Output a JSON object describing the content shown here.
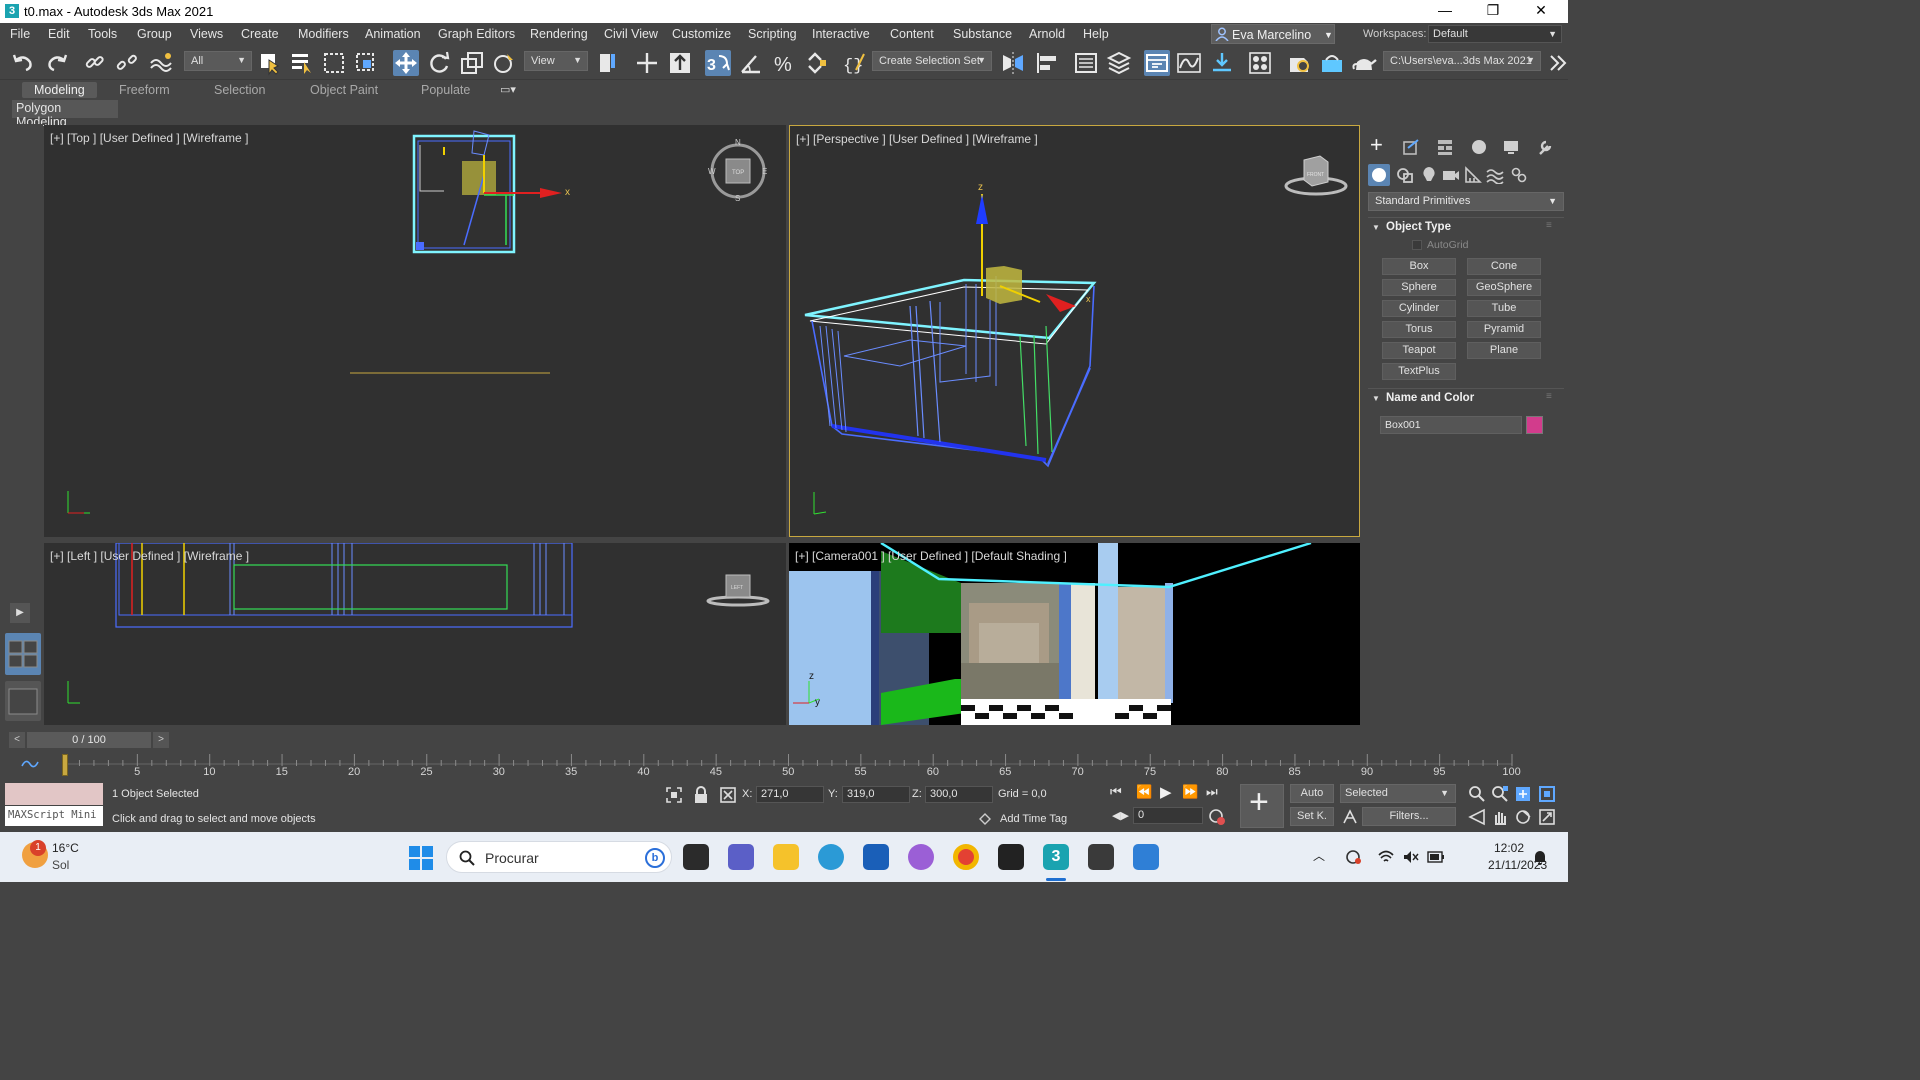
{
  "window": {
    "title": "t0.max - Autodesk 3ds Max 2021",
    "app_icon": "3",
    "controls": [
      "—",
      "❐",
      "✕"
    ]
  },
  "menu": {
    "items": [
      "File",
      "Edit",
      "Tools",
      "Group",
      "Views",
      "Create",
      "Modifiers",
      "Animation",
      "Graph Editors",
      "Rendering",
      "Civil View",
      "Customize",
      "Scripting",
      "Interactive",
      "Content",
      "Substance",
      "Arnold",
      "Help"
    ],
    "user_name": "Eva Marcelino",
    "workspaces_label": "Workspaces:",
    "workspace_value": "Default"
  },
  "toolbar": {
    "filter_value": "All",
    "ref_coord_value": "View",
    "selection_set_value": "Create Selection Set",
    "project_path": "C:\\Users\\eva...3ds Max 2021"
  },
  "ribbon": {
    "tabs": [
      "Modeling",
      "Freeform",
      "Selection",
      "Object Paint",
      "Populate"
    ],
    "active_tab": "Modeling",
    "sub_panel": "Polygon Modeling"
  },
  "viewports": {
    "top": {
      "label": "[+] [Top ] [User Defined ] [Wireframe ]",
      "compass": {
        "n": "N",
        "s": "S",
        "w": "W",
        "e": "E",
        "cube": "TOP"
      }
    },
    "perspective": {
      "label": "[+] [Perspective ] [User Defined ] [Wireframe ]",
      "cube": "FRONT"
    },
    "left": {
      "label": "[+] [Left ] [User Defined ] [Wireframe ]",
      "cube": "LEFT"
    },
    "camera": {
      "label": "[+] [Camera001 ] [User Defined ] [Default Shading ]"
    },
    "axis": {
      "x": "x",
      "y": "y",
      "z": "z"
    }
  },
  "command_panel": {
    "category_value": "Standard Primitives",
    "object_type_title": "Object Type",
    "autogrid_label": "AutoGrid",
    "buttons": [
      "Box",
      "Cone",
      "Sphere",
      "GeoSphere",
      "Cylinder",
      "Tube",
      "Torus",
      "Pyramid",
      "Teapot",
      "Plane",
      "TextPlus"
    ],
    "name_color_title": "Name and Color",
    "object_name": "Box001",
    "object_color": "#d23c8c"
  },
  "timeline": {
    "frame_display": "0 / 100",
    "prev": "<",
    "next": ">",
    "ticks": [
      "5",
      "10",
      "15",
      "20",
      "25",
      "30",
      "35",
      "40",
      "45",
      "50",
      "55",
      "60",
      "65",
      "70",
      "75",
      "80",
      "85",
      "90",
      "95",
      "100"
    ]
  },
  "status": {
    "maxscript_label": "MAXScript Mini",
    "selection_text": "1 Object Selected",
    "prompt_text": "Click and drag to select and move objects",
    "x_label": "X:",
    "x_value": "271,0",
    "y_label": "Y:",
    "y_value": "319,0",
    "z_label": "Z:",
    "z_value": "300,0",
    "grid_text": "Grid = 0,0",
    "add_time_tag": "Add Time Tag",
    "frame_field": "0",
    "auto_label": "Auto",
    "setkey_label": "Set K.",
    "selected_value": "Selected",
    "filters_label": "Filters..."
  },
  "taskbar": {
    "weather_temp": "16°C",
    "weather_desc": "Sol",
    "weather_badge": "1",
    "search_placeholder": "Procurar",
    "time": "12:02",
    "date": "21/11/2023"
  }
}
